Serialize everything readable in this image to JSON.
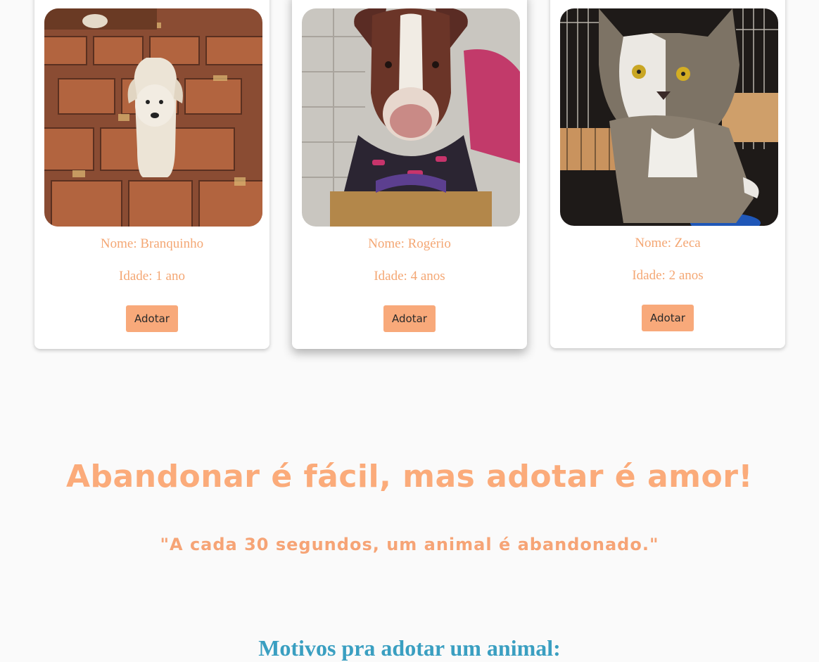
{
  "pets": [
    {
      "name": "Nome: Branquinho",
      "age": "Idade: 1 ano",
      "button": "Adotar"
    },
    {
      "name": "Nome: Rogério",
      "age": "Idade: 4 anos",
      "button": "Adotar"
    },
    {
      "name": "Nome: Zeca",
      "age": "Idade: 2 anos",
      "button": "Adotar"
    }
  ],
  "slogan": "Abandonar é fácil, mas adotar é amor!",
  "quote": "\"A cada 30 segundos, um animal é abandonado.\"",
  "reasons_heading": "Motivos pra adotar um animal:",
  "colors": {
    "accent": "#f8a97a",
    "text_orange": "#f4a774",
    "heading_blue": "#3a9fc1",
    "background": "#fafafa"
  }
}
